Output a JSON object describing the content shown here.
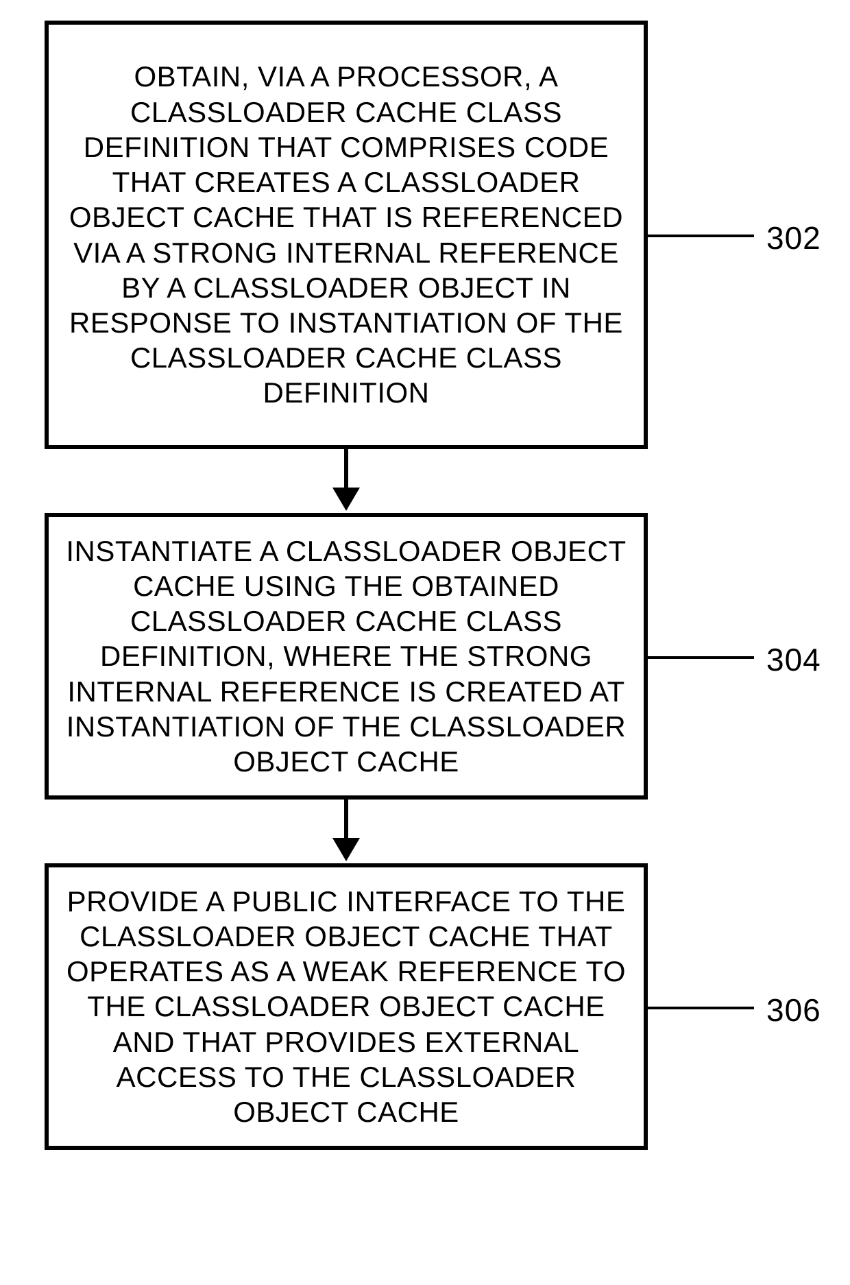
{
  "boxes": {
    "b1": "OBTAIN, VIA A PROCESSOR, A CLASSLOADER CACHE CLASS DEFINITION THAT COMPRISES CODE THAT CREATES A CLASSLOADER OBJECT CACHE THAT IS REFERENCED VIA A STRONG INTERNAL REFERENCE BY A CLASSLOADER OBJECT IN RESPONSE TO INSTANTIATION OF THE CLASSLOADER CACHE CLASS DEFINITION",
    "b2": "INSTANTIATE A CLASSLOADER OBJECT CACHE USING THE OBTAINED CLASSLOADER CACHE CLASS DEFINITION, WHERE THE STRONG INTERNAL REFERENCE IS CREATED AT INSTANTIATION OF THE CLASSLOADER OBJECT CACHE",
    "b3": "PROVIDE A PUBLIC INTERFACE TO THE CLASSLOADER OBJECT CACHE THAT OPERATES AS A WEAK REFERENCE TO THE CLASSLOADER OBJECT CACHE AND THAT PROVIDES EXTERNAL ACCESS TO THE CLASSLOADER OBJECT CACHE"
  },
  "labels": {
    "l1": "302",
    "l2": "304",
    "l3": "306"
  }
}
